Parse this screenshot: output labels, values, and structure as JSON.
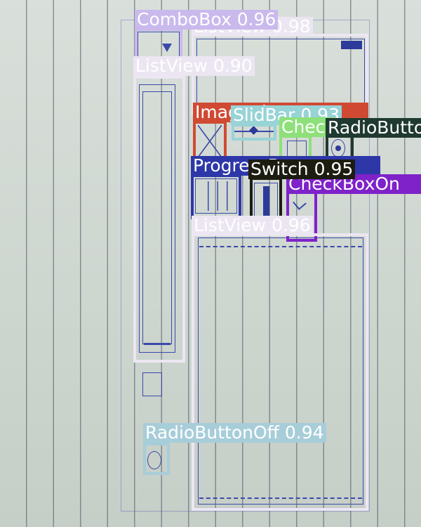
{
  "detections": [
    {
      "id": "listview-top",
      "text": "ListView 0.98",
      "color": "#ece6f2",
      "text_color": "#ffffff"
    },
    {
      "id": "combobox",
      "text": "ComboBox 0.96",
      "color": "#c9b9ec",
      "text_color": "#ffffff"
    },
    {
      "id": "listview-left",
      "text": "ListView 0.90",
      "color": "#ece6f2",
      "text_color": "#ffffff"
    },
    {
      "id": "imageview",
      "text": "ImageView",
      "color": "#d04a33",
      "text_color": "#ffffff"
    },
    {
      "id": "slidbar",
      "text": "SlidBar 0.93",
      "color": "#98d3d6",
      "text_color": "#ffffff"
    },
    {
      "id": "checkbox-off",
      "text": "CheckBoxOff",
      "color": "#8ee07a",
      "text_color": "#ffffff"
    },
    {
      "id": "radiobutton-on",
      "text": "RadioButtonOn",
      "color": "#1f3a30",
      "text_color": "#ffffff"
    },
    {
      "id": "progressbar",
      "text": "ProgressBar",
      "color": "#2d37a8",
      "text_color": "#ffffff"
    },
    {
      "id": "switch",
      "text": "Switch 0.95",
      "color": "#1c1d10",
      "text_color": "#ffffff"
    },
    {
      "id": "checkbox-on",
      "text": "CheckBoxOn",
      "color": "#7f22c9",
      "text_color": "#ffffff"
    },
    {
      "id": "listview-bottom",
      "text": "ListView 0.96",
      "color": "#ece6f2",
      "text_color": "#ffffff"
    },
    {
      "id": "radiobutton-off",
      "text": "RadioButtonOff 0.94",
      "color": "#a7cdd9",
      "text_color": "#ffffff"
    }
  ]
}
